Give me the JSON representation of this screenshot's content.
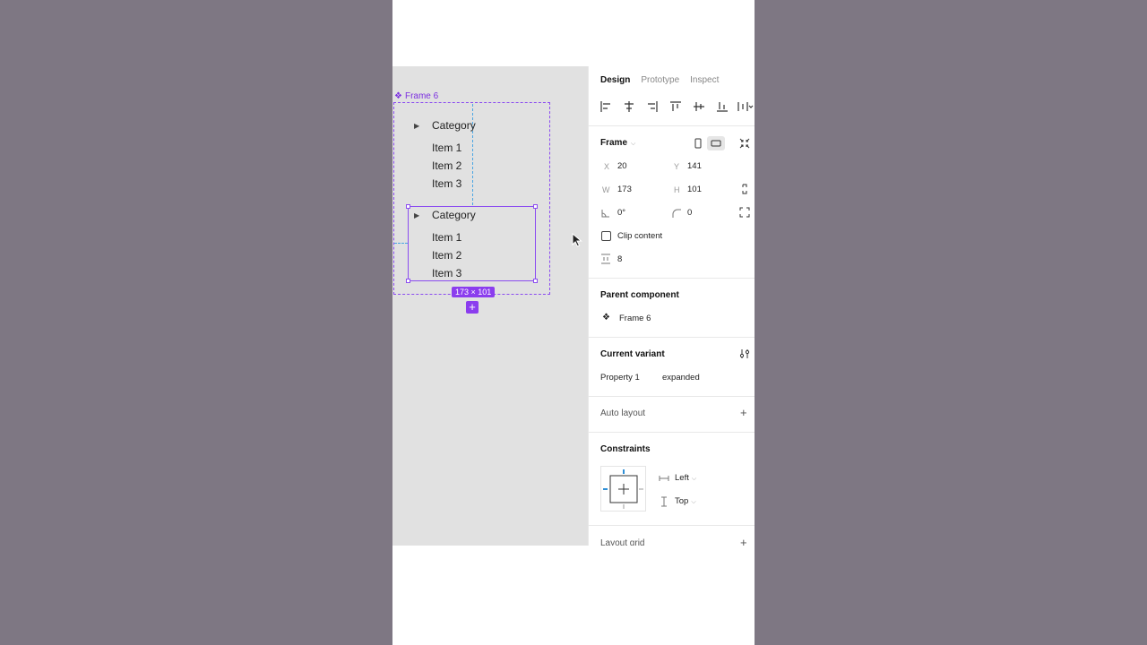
{
  "canvas": {
    "frame_label": "Frame 6",
    "size_badge": "173 × 101",
    "groups": [
      {
        "category": "Category",
        "items": [
          "Item 1",
          "Item 2",
          "Item 3"
        ]
      },
      {
        "category": "Category",
        "items": [
          "Item 1",
          "Item 2",
          "Item 3"
        ]
      }
    ]
  },
  "panel": {
    "tabs": [
      "Design",
      "Prototype",
      "Inspect"
    ],
    "active_tab": "Design",
    "frame": {
      "title": "Frame",
      "x_label": "X",
      "x": "20",
      "y_label": "Y",
      "y": "141",
      "w_label": "W",
      "w": "173",
      "h_label": "H",
      "h": "101",
      "rotation": "0°",
      "radius": "0",
      "clip_content": "Clip content",
      "spacing": "8"
    },
    "parent_component": {
      "title": "Parent component",
      "name": "Frame 6"
    },
    "current_variant": {
      "title": "Current variant",
      "property": "Property 1",
      "value": "expanded"
    },
    "auto_layout": {
      "title": "Auto layout"
    },
    "constraints": {
      "title": "Constraints",
      "horizontal": "Left",
      "vertical": "Top"
    },
    "layout_grid": {
      "title": "Layout grid"
    }
  },
  "colors": {
    "accent": "#8b3dee",
    "guide": "#4aa6e3",
    "backdrop": "#7e7783",
    "canvas_bg": "#e1e1e1"
  }
}
